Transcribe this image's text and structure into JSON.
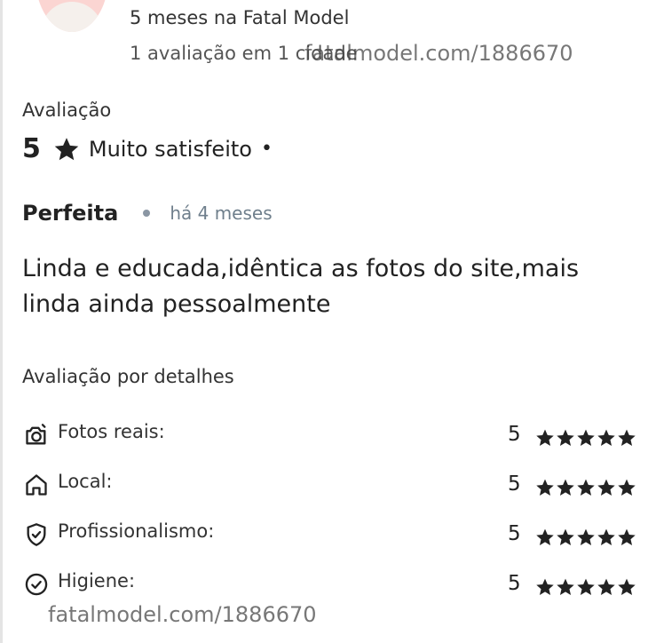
{
  "reviewer": {
    "tenure": "5 meses na Fatal Model",
    "reviews_count": "1 avaliação em 1 cidade"
  },
  "watermark": "fatalmodel.com/1886670",
  "rating": {
    "label": "Avaliação",
    "score": "5",
    "sentiment": "Muito satisfeito",
    "separator": "•"
  },
  "review": {
    "title": "Perfeita",
    "time": "há 4 meses",
    "body": "Linda e educada,idêntica as fotos do site,mais linda ainda pessoalmente"
  },
  "details": {
    "label": "Avaliação por detalhes",
    "items": [
      {
        "label": "Fotos reais:",
        "score": "5",
        "stars": 5,
        "icon": "camera-icon"
      },
      {
        "label": "Local:",
        "score": "5",
        "stars": 5,
        "icon": "home-icon"
      },
      {
        "label": "Profissionalismo:",
        "score": "5",
        "stars": 5,
        "icon": "shield-check-icon"
      },
      {
        "label": "Higiene:",
        "score": "5",
        "stars": 5,
        "icon": "check-circle-icon"
      }
    ]
  },
  "colors": {
    "text": "#2b2b2b",
    "muted": "#6f7f8c",
    "avatar": "#fbd5d2"
  }
}
